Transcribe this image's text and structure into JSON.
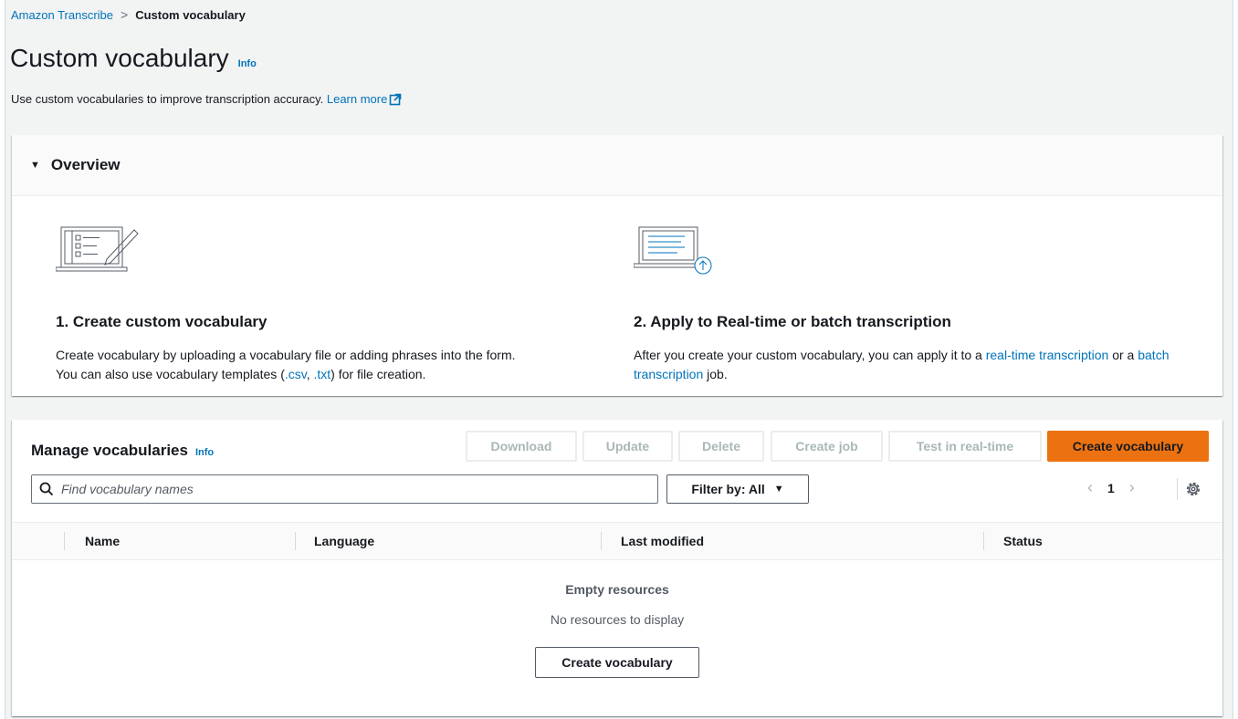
{
  "breadcrumb": {
    "parent": "Amazon Transcribe",
    "current": "Custom vocabulary"
  },
  "page": {
    "title": "Custom vocabulary",
    "info": "Info",
    "description": "Use custom vocabularies to improve transcription accuracy.",
    "learn_more": "Learn more"
  },
  "overview": {
    "header": "Overview",
    "step1": {
      "title": "1. Create custom vocabulary",
      "line1": "Create vocabulary by uploading a vocabulary file or adding phrases into the form.",
      "line2_pre": "You can also use vocabulary templates (",
      "csv": ".csv",
      "comma": ", ",
      "txt": ".txt",
      "line2_post": ") for file creation."
    },
    "step2": {
      "title": "2. Apply to Real-time or batch transcription",
      "pre": "After you create your custom vocabulary, you can apply it to a ",
      "link1": "real-time transcription",
      "mid": " or a ",
      "link2": "batch transcription",
      "post": " job."
    }
  },
  "manage": {
    "title": "Manage vocabularies",
    "info": "Info",
    "buttons": {
      "download": "Download",
      "update": "Update",
      "delete": "Delete",
      "create_job": "Create job",
      "test_realtime": "Test in real-time",
      "create_vocabulary": "Create vocabulary"
    },
    "search_placeholder": "Find vocabulary names",
    "filter_label": "Filter by: All",
    "page_number": "1",
    "columns": [
      "Name",
      "Language",
      "Last modified",
      "Status"
    ],
    "empty_title": "Empty resources",
    "empty_subtitle": "No resources to display",
    "empty_button": "Create vocabulary"
  },
  "icons": {
    "search": "search-icon",
    "gear": "gear-icon",
    "external": "external-link-icon",
    "caret": "caret-down-icon"
  },
  "colors": {
    "accent": "#ec7211",
    "link": "#0073bb"
  }
}
